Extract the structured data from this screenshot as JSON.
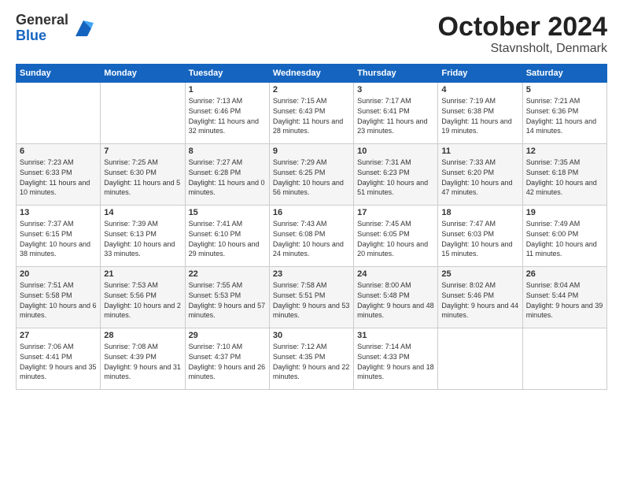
{
  "logo": {
    "general": "General",
    "blue": "Blue"
  },
  "title": {
    "month_year": "October 2024",
    "location": "Stavnsholt, Denmark"
  },
  "days_header": [
    "Sunday",
    "Monday",
    "Tuesday",
    "Wednesday",
    "Thursday",
    "Friday",
    "Saturday"
  ],
  "weeks": [
    [
      {
        "num": "",
        "sunrise": "",
        "sunset": "",
        "daylight": ""
      },
      {
        "num": "",
        "sunrise": "",
        "sunset": "",
        "daylight": ""
      },
      {
        "num": "1",
        "sunrise": "Sunrise: 7:13 AM",
        "sunset": "Sunset: 6:46 PM",
        "daylight": "Daylight: 11 hours and 32 minutes."
      },
      {
        "num": "2",
        "sunrise": "Sunrise: 7:15 AM",
        "sunset": "Sunset: 6:43 PM",
        "daylight": "Daylight: 11 hours and 28 minutes."
      },
      {
        "num": "3",
        "sunrise": "Sunrise: 7:17 AM",
        "sunset": "Sunset: 6:41 PM",
        "daylight": "Daylight: 11 hours and 23 minutes."
      },
      {
        "num": "4",
        "sunrise": "Sunrise: 7:19 AM",
        "sunset": "Sunset: 6:38 PM",
        "daylight": "Daylight: 11 hours and 19 minutes."
      },
      {
        "num": "5",
        "sunrise": "Sunrise: 7:21 AM",
        "sunset": "Sunset: 6:36 PM",
        "daylight": "Daylight: 11 hours and 14 minutes."
      }
    ],
    [
      {
        "num": "6",
        "sunrise": "Sunrise: 7:23 AM",
        "sunset": "Sunset: 6:33 PM",
        "daylight": "Daylight: 11 hours and 10 minutes."
      },
      {
        "num": "7",
        "sunrise": "Sunrise: 7:25 AM",
        "sunset": "Sunset: 6:30 PM",
        "daylight": "Daylight: 11 hours and 5 minutes."
      },
      {
        "num": "8",
        "sunrise": "Sunrise: 7:27 AM",
        "sunset": "Sunset: 6:28 PM",
        "daylight": "Daylight: 11 hours and 0 minutes."
      },
      {
        "num": "9",
        "sunrise": "Sunrise: 7:29 AM",
        "sunset": "Sunset: 6:25 PM",
        "daylight": "Daylight: 10 hours and 56 minutes."
      },
      {
        "num": "10",
        "sunrise": "Sunrise: 7:31 AM",
        "sunset": "Sunset: 6:23 PM",
        "daylight": "Daylight: 10 hours and 51 minutes."
      },
      {
        "num": "11",
        "sunrise": "Sunrise: 7:33 AM",
        "sunset": "Sunset: 6:20 PM",
        "daylight": "Daylight: 10 hours and 47 minutes."
      },
      {
        "num": "12",
        "sunrise": "Sunrise: 7:35 AM",
        "sunset": "Sunset: 6:18 PM",
        "daylight": "Daylight: 10 hours and 42 minutes."
      }
    ],
    [
      {
        "num": "13",
        "sunrise": "Sunrise: 7:37 AM",
        "sunset": "Sunset: 6:15 PM",
        "daylight": "Daylight: 10 hours and 38 minutes."
      },
      {
        "num": "14",
        "sunrise": "Sunrise: 7:39 AM",
        "sunset": "Sunset: 6:13 PM",
        "daylight": "Daylight: 10 hours and 33 minutes."
      },
      {
        "num": "15",
        "sunrise": "Sunrise: 7:41 AM",
        "sunset": "Sunset: 6:10 PM",
        "daylight": "Daylight: 10 hours and 29 minutes."
      },
      {
        "num": "16",
        "sunrise": "Sunrise: 7:43 AM",
        "sunset": "Sunset: 6:08 PM",
        "daylight": "Daylight: 10 hours and 24 minutes."
      },
      {
        "num": "17",
        "sunrise": "Sunrise: 7:45 AM",
        "sunset": "Sunset: 6:05 PM",
        "daylight": "Daylight: 10 hours and 20 minutes."
      },
      {
        "num": "18",
        "sunrise": "Sunrise: 7:47 AM",
        "sunset": "Sunset: 6:03 PM",
        "daylight": "Daylight: 10 hours and 15 minutes."
      },
      {
        "num": "19",
        "sunrise": "Sunrise: 7:49 AM",
        "sunset": "Sunset: 6:00 PM",
        "daylight": "Daylight: 10 hours and 11 minutes."
      }
    ],
    [
      {
        "num": "20",
        "sunrise": "Sunrise: 7:51 AM",
        "sunset": "Sunset: 5:58 PM",
        "daylight": "Daylight: 10 hours and 6 minutes."
      },
      {
        "num": "21",
        "sunrise": "Sunrise: 7:53 AM",
        "sunset": "Sunset: 5:56 PM",
        "daylight": "Daylight: 10 hours and 2 minutes."
      },
      {
        "num": "22",
        "sunrise": "Sunrise: 7:55 AM",
        "sunset": "Sunset: 5:53 PM",
        "daylight": "Daylight: 9 hours and 57 minutes."
      },
      {
        "num": "23",
        "sunrise": "Sunrise: 7:58 AM",
        "sunset": "Sunset: 5:51 PM",
        "daylight": "Daylight: 9 hours and 53 minutes."
      },
      {
        "num": "24",
        "sunrise": "Sunrise: 8:00 AM",
        "sunset": "Sunset: 5:48 PM",
        "daylight": "Daylight: 9 hours and 48 minutes."
      },
      {
        "num": "25",
        "sunrise": "Sunrise: 8:02 AM",
        "sunset": "Sunset: 5:46 PM",
        "daylight": "Daylight: 9 hours and 44 minutes."
      },
      {
        "num": "26",
        "sunrise": "Sunrise: 8:04 AM",
        "sunset": "Sunset: 5:44 PM",
        "daylight": "Daylight: 9 hours and 39 minutes."
      }
    ],
    [
      {
        "num": "27",
        "sunrise": "Sunrise: 7:06 AM",
        "sunset": "Sunset: 4:41 PM",
        "daylight": "Daylight: 9 hours and 35 minutes."
      },
      {
        "num": "28",
        "sunrise": "Sunrise: 7:08 AM",
        "sunset": "Sunset: 4:39 PM",
        "daylight": "Daylight: 9 hours and 31 minutes."
      },
      {
        "num": "29",
        "sunrise": "Sunrise: 7:10 AM",
        "sunset": "Sunset: 4:37 PM",
        "daylight": "Daylight: 9 hours and 26 minutes."
      },
      {
        "num": "30",
        "sunrise": "Sunrise: 7:12 AM",
        "sunset": "Sunset: 4:35 PM",
        "daylight": "Daylight: 9 hours and 22 minutes."
      },
      {
        "num": "31",
        "sunrise": "Sunrise: 7:14 AM",
        "sunset": "Sunset: 4:33 PM",
        "daylight": "Daylight: 9 hours and 18 minutes."
      },
      {
        "num": "",
        "sunrise": "",
        "sunset": "",
        "daylight": ""
      },
      {
        "num": "",
        "sunrise": "",
        "sunset": "",
        "daylight": ""
      }
    ]
  ]
}
